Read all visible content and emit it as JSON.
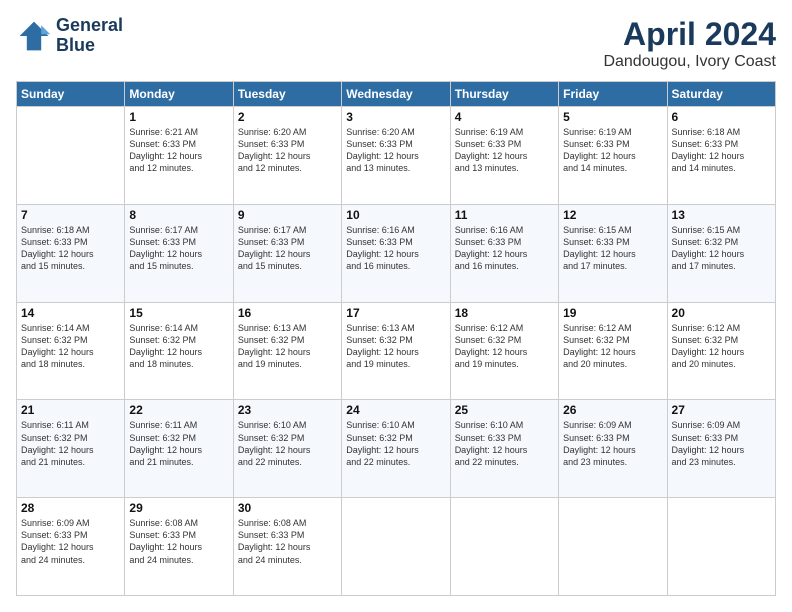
{
  "header": {
    "logo_line1": "General",
    "logo_line2": "Blue",
    "month": "April 2024",
    "location": "Dandougou, Ivory Coast"
  },
  "weekdays": [
    "Sunday",
    "Monday",
    "Tuesday",
    "Wednesday",
    "Thursday",
    "Friday",
    "Saturday"
  ],
  "weeks": [
    [
      {
        "day": "",
        "info": ""
      },
      {
        "day": "1",
        "info": "Sunrise: 6:21 AM\nSunset: 6:33 PM\nDaylight: 12 hours\nand 12 minutes."
      },
      {
        "day": "2",
        "info": "Sunrise: 6:20 AM\nSunset: 6:33 PM\nDaylight: 12 hours\nand 12 minutes."
      },
      {
        "day": "3",
        "info": "Sunrise: 6:20 AM\nSunset: 6:33 PM\nDaylight: 12 hours\nand 13 minutes."
      },
      {
        "day": "4",
        "info": "Sunrise: 6:19 AM\nSunset: 6:33 PM\nDaylight: 12 hours\nand 13 minutes."
      },
      {
        "day": "5",
        "info": "Sunrise: 6:19 AM\nSunset: 6:33 PM\nDaylight: 12 hours\nand 14 minutes."
      },
      {
        "day": "6",
        "info": "Sunrise: 6:18 AM\nSunset: 6:33 PM\nDaylight: 12 hours\nand 14 minutes."
      }
    ],
    [
      {
        "day": "7",
        "info": "Sunrise: 6:18 AM\nSunset: 6:33 PM\nDaylight: 12 hours\nand 15 minutes."
      },
      {
        "day": "8",
        "info": "Sunrise: 6:17 AM\nSunset: 6:33 PM\nDaylight: 12 hours\nand 15 minutes."
      },
      {
        "day": "9",
        "info": "Sunrise: 6:17 AM\nSunset: 6:33 PM\nDaylight: 12 hours\nand 15 minutes."
      },
      {
        "day": "10",
        "info": "Sunrise: 6:16 AM\nSunset: 6:33 PM\nDaylight: 12 hours\nand 16 minutes."
      },
      {
        "day": "11",
        "info": "Sunrise: 6:16 AM\nSunset: 6:33 PM\nDaylight: 12 hours\nand 16 minutes."
      },
      {
        "day": "12",
        "info": "Sunrise: 6:15 AM\nSunset: 6:33 PM\nDaylight: 12 hours\nand 17 minutes."
      },
      {
        "day": "13",
        "info": "Sunrise: 6:15 AM\nSunset: 6:32 PM\nDaylight: 12 hours\nand 17 minutes."
      }
    ],
    [
      {
        "day": "14",
        "info": "Sunrise: 6:14 AM\nSunset: 6:32 PM\nDaylight: 12 hours\nand 18 minutes."
      },
      {
        "day": "15",
        "info": "Sunrise: 6:14 AM\nSunset: 6:32 PM\nDaylight: 12 hours\nand 18 minutes."
      },
      {
        "day": "16",
        "info": "Sunrise: 6:13 AM\nSunset: 6:32 PM\nDaylight: 12 hours\nand 19 minutes."
      },
      {
        "day": "17",
        "info": "Sunrise: 6:13 AM\nSunset: 6:32 PM\nDaylight: 12 hours\nand 19 minutes."
      },
      {
        "day": "18",
        "info": "Sunrise: 6:12 AM\nSunset: 6:32 PM\nDaylight: 12 hours\nand 19 minutes."
      },
      {
        "day": "19",
        "info": "Sunrise: 6:12 AM\nSunset: 6:32 PM\nDaylight: 12 hours\nand 20 minutes."
      },
      {
        "day": "20",
        "info": "Sunrise: 6:12 AM\nSunset: 6:32 PM\nDaylight: 12 hours\nand 20 minutes."
      }
    ],
    [
      {
        "day": "21",
        "info": "Sunrise: 6:11 AM\nSunset: 6:32 PM\nDaylight: 12 hours\nand 21 minutes."
      },
      {
        "day": "22",
        "info": "Sunrise: 6:11 AM\nSunset: 6:32 PM\nDaylight: 12 hours\nand 21 minutes."
      },
      {
        "day": "23",
        "info": "Sunrise: 6:10 AM\nSunset: 6:32 PM\nDaylight: 12 hours\nand 22 minutes."
      },
      {
        "day": "24",
        "info": "Sunrise: 6:10 AM\nSunset: 6:32 PM\nDaylight: 12 hours\nand 22 minutes."
      },
      {
        "day": "25",
        "info": "Sunrise: 6:10 AM\nSunset: 6:33 PM\nDaylight: 12 hours\nand 22 minutes."
      },
      {
        "day": "26",
        "info": "Sunrise: 6:09 AM\nSunset: 6:33 PM\nDaylight: 12 hours\nand 23 minutes."
      },
      {
        "day": "27",
        "info": "Sunrise: 6:09 AM\nSunset: 6:33 PM\nDaylight: 12 hours\nand 23 minutes."
      }
    ],
    [
      {
        "day": "28",
        "info": "Sunrise: 6:09 AM\nSunset: 6:33 PM\nDaylight: 12 hours\nand 24 minutes."
      },
      {
        "day": "29",
        "info": "Sunrise: 6:08 AM\nSunset: 6:33 PM\nDaylight: 12 hours\nand 24 minutes."
      },
      {
        "day": "30",
        "info": "Sunrise: 6:08 AM\nSunset: 6:33 PM\nDaylight: 12 hours\nand 24 minutes."
      },
      {
        "day": "",
        "info": ""
      },
      {
        "day": "",
        "info": ""
      },
      {
        "day": "",
        "info": ""
      },
      {
        "day": "",
        "info": ""
      }
    ]
  ]
}
